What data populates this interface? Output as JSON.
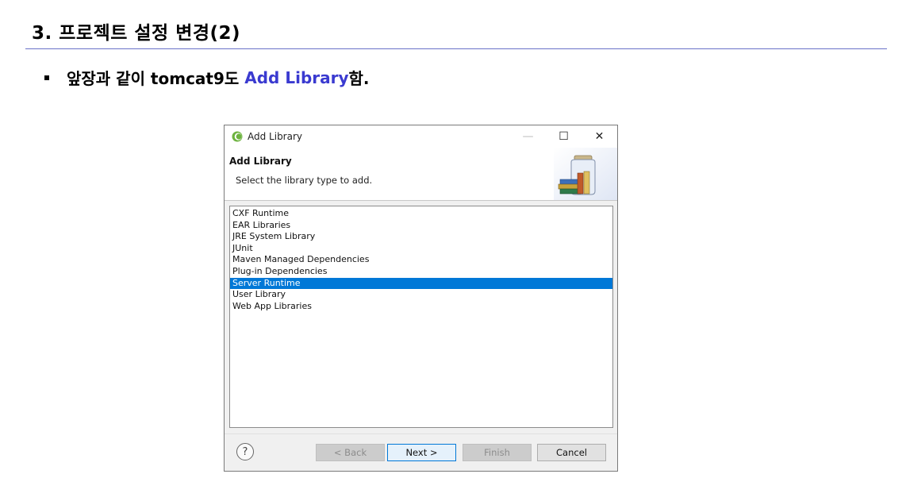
{
  "slide": {
    "title": "3. 프로젝트 설정 변경(2)",
    "bullet_prefix": "앞장과 같이 tomcat9도 ",
    "bullet_accent": "Add Library",
    "bullet_suffix": "함."
  },
  "dialog": {
    "window_title": "Add Library",
    "header_title": "Add Library",
    "header_description": "Select the library type to add.",
    "controls": {
      "minimize": "—",
      "maximize": "☐",
      "close": "✕"
    },
    "library_types": [
      "CXF Runtime",
      "EAR Libraries",
      "JRE System Library",
      "JUnit",
      "Maven Managed Dependencies",
      "Plug-in Dependencies",
      "Server Runtime",
      "User Library",
      "Web App Libraries"
    ],
    "selected_index": 6,
    "buttons": {
      "help": "?",
      "back": "< Back",
      "next": "Next >",
      "finish": "Finish",
      "cancel": "Cancel"
    }
  },
  "colors": {
    "accent_text": "#3a3ad0",
    "selection": "#0078d7",
    "title_rule": "#6a72c8"
  }
}
